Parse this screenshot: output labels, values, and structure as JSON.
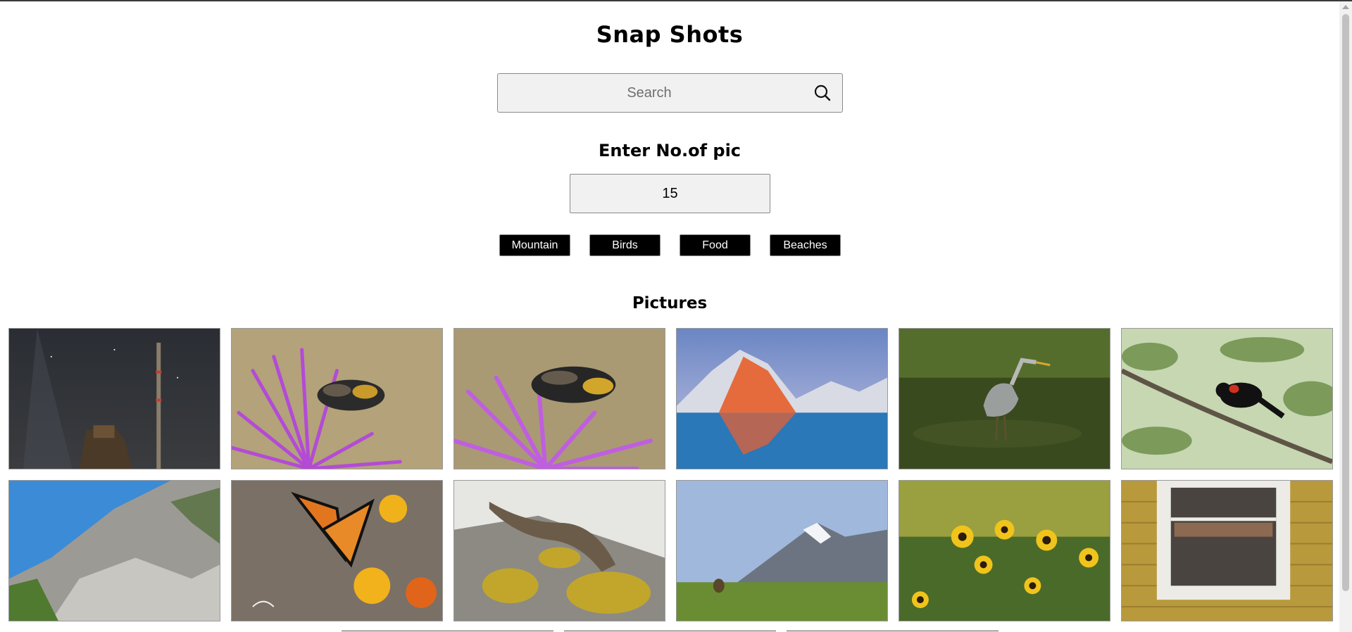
{
  "header": {
    "title": "Snap Shots"
  },
  "search": {
    "placeholder": "Search",
    "value": "",
    "icon": "search-icon"
  },
  "count": {
    "label": "Enter No.of pic",
    "value": "15"
  },
  "categories": [
    {
      "label": "Mountain"
    },
    {
      "label": "Birds"
    },
    {
      "label": "Food"
    },
    {
      "label": "Beaches"
    }
  ],
  "gallery": {
    "heading": "Pictures",
    "photos": [
      {
        "subject": "night-sky-tower"
      },
      {
        "subject": "bee-on-thistle"
      },
      {
        "subject": "bee-on-thistle-closeup"
      },
      {
        "subject": "mountain-lake-sunrise"
      },
      {
        "subject": "heron-in-water"
      },
      {
        "subject": "red-winged-blackbird"
      },
      {
        "subject": "rocky-cliff"
      },
      {
        "subject": "monarch-butterfly"
      },
      {
        "subject": "otter-on-rock"
      },
      {
        "subject": "marmot-meadow"
      },
      {
        "subject": "black-eyed-susans"
      },
      {
        "subject": "old-window"
      }
    ]
  },
  "colors": {
    "button_bg": "#000000",
    "button_text": "#ffffff",
    "input_bg": "#f1f1f1"
  }
}
